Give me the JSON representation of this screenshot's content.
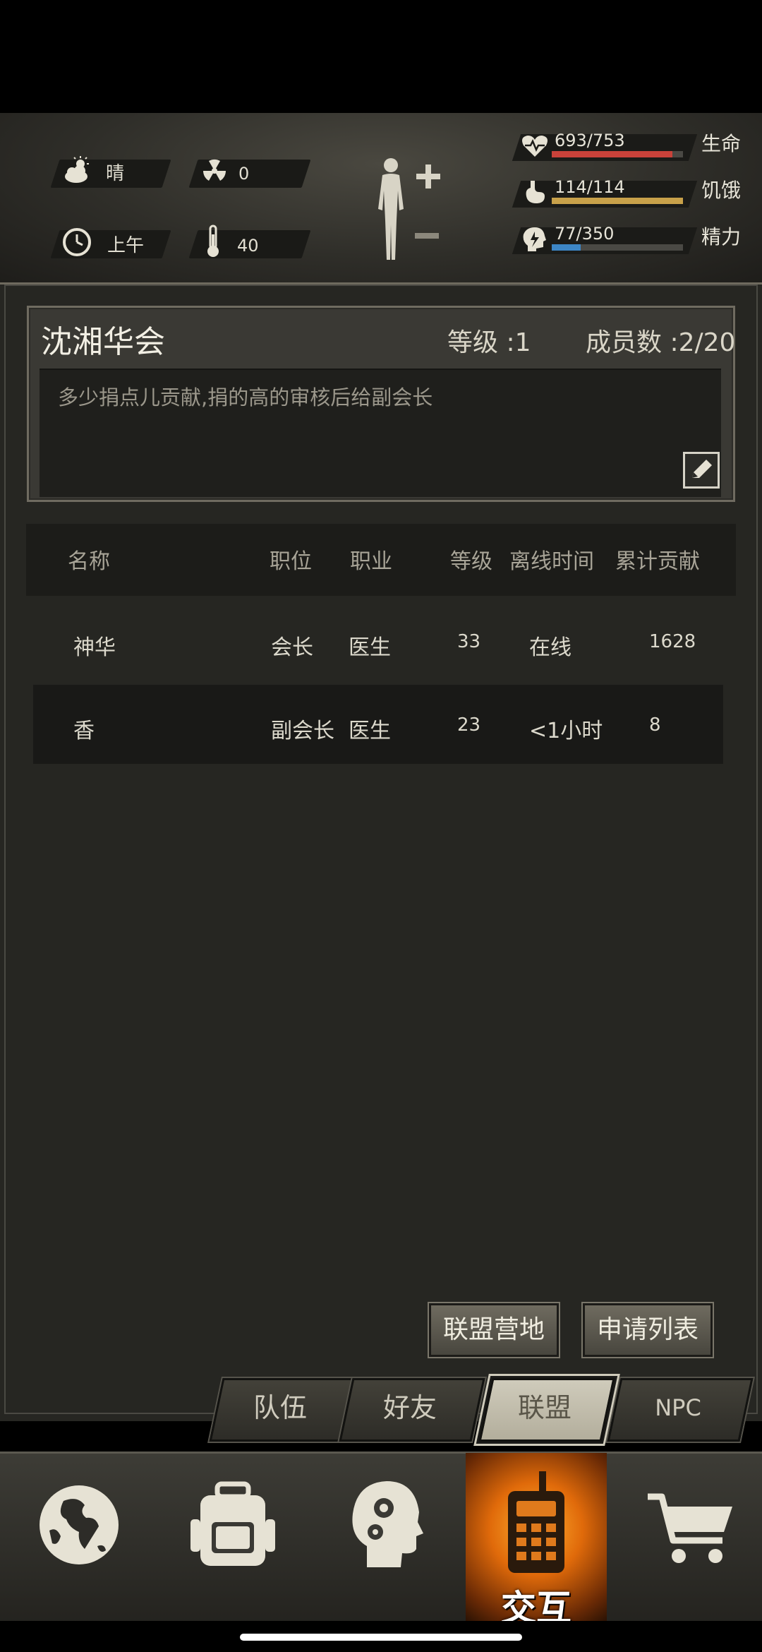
{
  "status": {
    "weather": "晴",
    "radiation": "0",
    "time_of_day": "上午",
    "temperature": "40",
    "weather_icon": "cloudy-sun-icon",
    "radiation_icon": "radiation-icon",
    "clock_icon": "clock-icon",
    "thermometer_icon": "thermometer-icon"
  },
  "stats": [
    {
      "value": "693/753",
      "label": "生命",
      "fraction": 0.92,
      "color": "#c9423a",
      "icon": "heart-pulse-icon"
    },
    {
      "value": "114/114",
      "label": "饥饿",
      "fraction": 1.0,
      "color": "#c8a14a",
      "icon": "stomach-icon"
    },
    {
      "value": "77/350",
      "label": "精力",
      "fraction": 0.22,
      "color": "#3d86c6",
      "icon": "energy-head-icon"
    }
  ],
  "guild": {
    "name": "沈湘华会",
    "level_label": "等级 :1",
    "members_label": "成员数 :2/20",
    "notice": "多少捐点儿贡献,捐的高的审核后给副会长"
  },
  "table": {
    "headers": [
      "名称",
      "职位",
      "职业",
      "等级",
      "离线时间",
      "累计贡献"
    ],
    "rows": [
      [
        "神华",
        "会长",
        "医生",
        "33",
        "在线",
        "1628"
      ],
      [
        "香",
        "副会长",
        "医生",
        "23",
        "<1小时",
        "8"
      ]
    ]
  },
  "buttons": {
    "alliance_camp": "联盟营地",
    "apply_list": "申请列表"
  },
  "tabs": [
    {
      "label": "队伍",
      "active": false
    },
    {
      "label": "好友",
      "active": false
    },
    {
      "label": "联盟",
      "active": true
    },
    {
      "label": "NPC",
      "active": false
    }
  ],
  "nav": {
    "items": [
      "globe-icon",
      "backpack-icon",
      "skills-head-icon",
      "walkie-talkie-icon",
      "cart-icon"
    ],
    "active_label": "交互"
  }
}
